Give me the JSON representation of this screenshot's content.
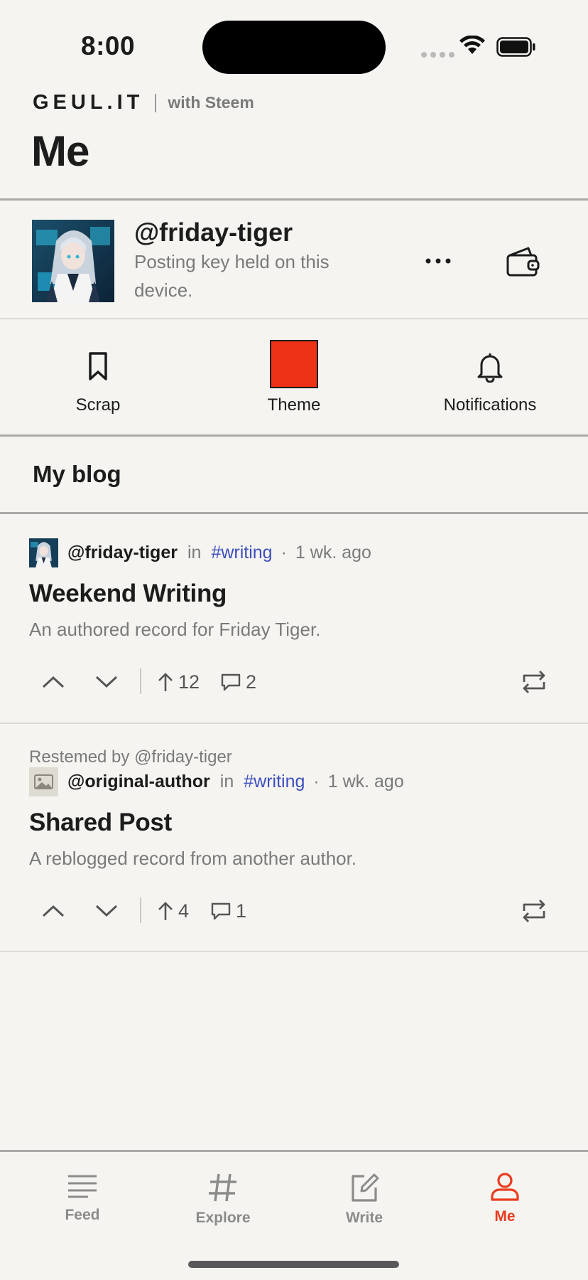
{
  "status_bar": {
    "time": "8:00"
  },
  "header": {
    "brand": "GEUL.IT",
    "brand_sub": "with Steem",
    "title": "Me"
  },
  "profile": {
    "username": "@friday-tiger",
    "key_note": "Posting key held on this device."
  },
  "quick_actions": [
    {
      "label": "Scrap",
      "icon": "bookmark-icon"
    },
    {
      "label": "Theme",
      "icon": "theme-swatch",
      "color": "#ed3217"
    },
    {
      "label": "Notifications",
      "icon": "bell-icon"
    }
  ],
  "section": {
    "title": "My blog"
  },
  "posts": [
    {
      "resteemed_by": "",
      "author": "@friday-tiger",
      "in_label": "in",
      "tag": "#writing",
      "age": "1 wk. ago",
      "title": "Weekend Writing",
      "excerpt": "An authored record for Friday Tiger.",
      "votes": "12",
      "comments": "2"
    },
    {
      "resteemed_by": "Restemed by @friday-tiger",
      "author": "@original-author",
      "in_label": "in",
      "tag": "#writing",
      "age": "1 wk. ago",
      "title": "Shared Post",
      "excerpt": "A reblogged record from another author.",
      "votes": "4",
      "comments": "1"
    }
  ],
  "tabs": [
    {
      "label": "Feed",
      "icon": "feed-icon",
      "active": false
    },
    {
      "label": "Explore",
      "icon": "hash-icon",
      "active": false
    },
    {
      "label": "Write",
      "icon": "compose-icon",
      "active": false
    },
    {
      "label": "Me",
      "icon": "person-icon",
      "active": true
    }
  ],
  "colors": {
    "accent": "#ea3b1e",
    "tag": "#3d4fc0",
    "background": "#f5f4f0"
  }
}
